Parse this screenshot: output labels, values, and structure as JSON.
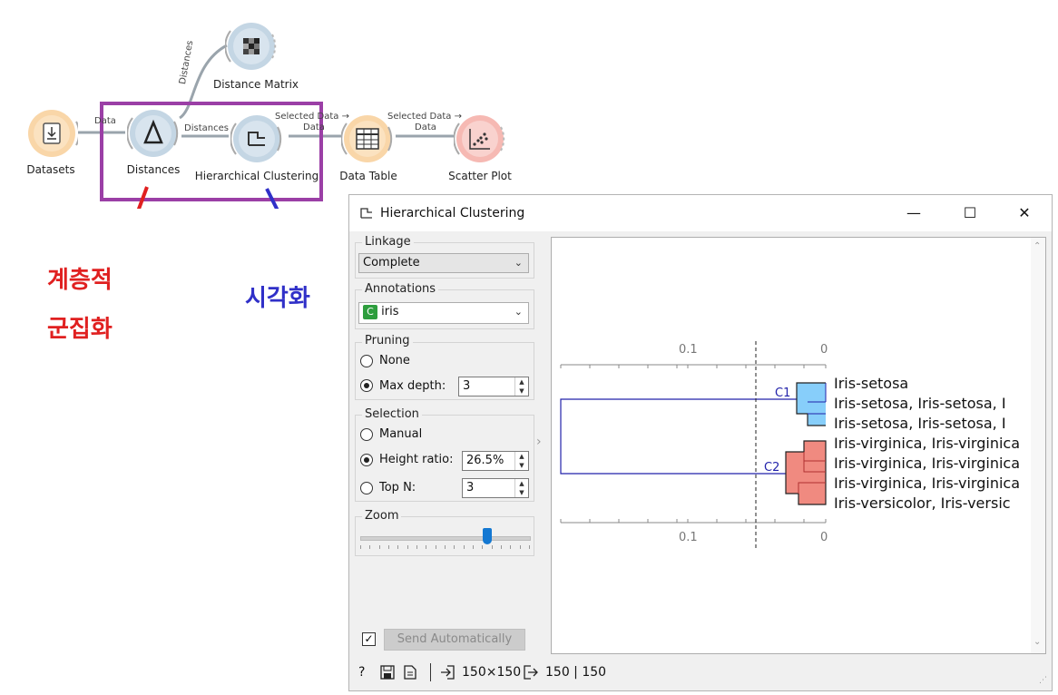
{
  "workflow": {
    "nodes": {
      "datasets": "Datasets",
      "distances": "Distances",
      "distance_matrix": "Distance Matrix",
      "hierarchical_clustering": "Hierarchical Clustering",
      "data_table": "Data Table",
      "scatter_plot": "Scatter Plot"
    },
    "links": {
      "data": "Data",
      "distances_up": "Distances",
      "distances": "Distances",
      "selected_data_1": "Selected Data →",
      "data_1": "Data",
      "selected_data_2": "Selected Data →",
      "data_2": "Data"
    }
  },
  "annotations": {
    "red_line1": "계층적",
    "red_line2": "군집화",
    "blue": "시각화",
    "red_color": "#e02020",
    "blue_color": "#3030c8",
    "box_color": "#9b3fa6"
  },
  "window": {
    "title": "Hierarchical Clustering",
    "minimize": "—",
    "maximize": "☐",
    "close": "✕"
  },
  "panel": {
    "linkage": {
      "title": "Linkage",
      "value": "Complete"
    },
    "annotations": {
      "title": "Annotations",
      "badge": "C",
      "value": "iris"
    },
    "pruning": {
      "title": "Pruning",
      "none": "None",
      "max_depth": "Max depth:",
      "max_depth_value": "3",
      "selected": "max_depth"
    },
    "selection": {
      "title": "Selection",
      "manual": "Manual",
      "height_ratio": "Height ratio:",
      "height_ratio_value": "26.5%",
      "top_n": "Top N:",
      "top_n_value": "3",
      "selected": "height_ratio"
    },
    "zoom": {
      "title": "Zoom",
      "level": 0.75
    },
    "send_automatically": "Send Automatically",
    "send_checked": "✓"
  },
  "dendrogram": {
    "top_ticks": [
      "0.1",
      "0"
    ],
    "bottom_ticks": [
      "0.1",
      "0"
    ],
    "clusters": [
      "C1",
      "C2"
    ],
    "leaves": [
      "Iris-setosa",
      "Iris-setosa, Iris-setosa, I",
      "Iris-setosa, Iris-setosa, I",
      "Iris-virginica, Iris-virginica",
      "Iris-virginica, Iris-virginica",
      "Iris-virginica, Iris-virginica",
      "Iris-versicolor, Iris-versic"
    ],
    "c1_color": "#87cefa",
    "c2_color": "#f08a80"
  },
  "statusbar": {
    "input": "150×150",
    "output": "150 | 150"
  }
}
